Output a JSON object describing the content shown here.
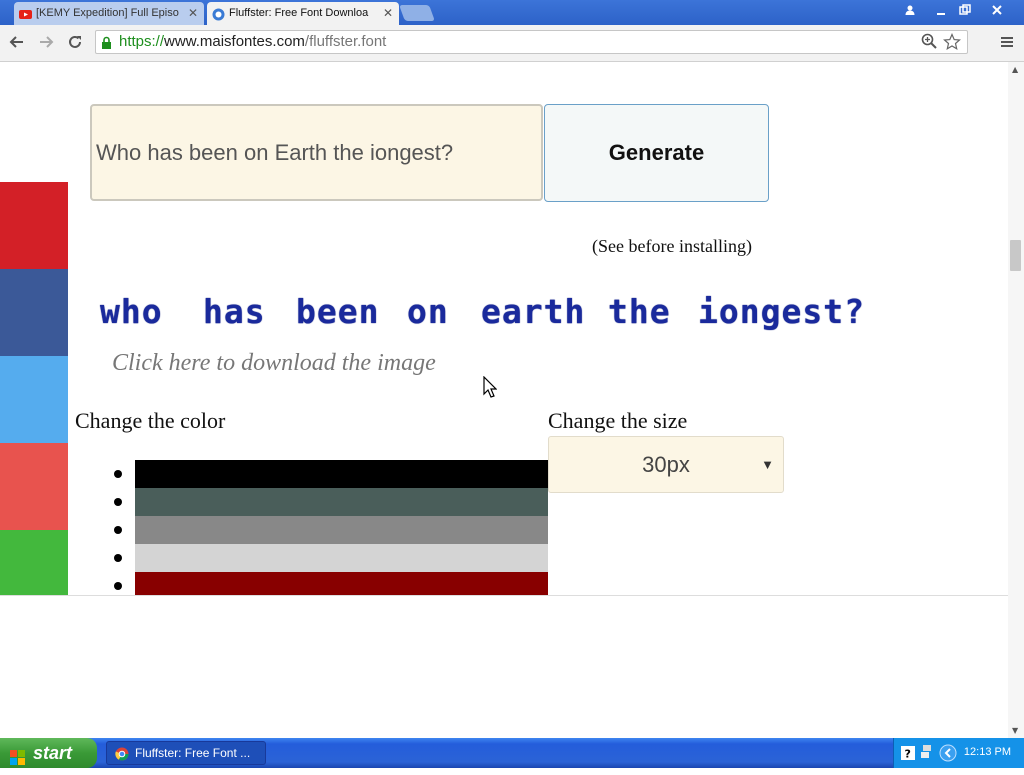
{
  "browser": {
    "tabs": [
      {
        "title": "[KEMY Expedition] Full Episo",
        "favicon": "youtube-icon",
        "active": false
      },
      {
        "title": "Fluffster: Free Font Downloa",
        "favicon": "maisfontes-icon",
        "active": true
      }
    ],
    "close_glyph": "✕",
    "url_scheme": "https://",
    "url_host": "www.maisfontes.com",
    "url_path": "/fluffster.font"
  },
  "page": {
    "text_value": "Who has been on Earth the iongest?",
    "generate_label": "Generate",
    "see_before": "(See before installing)",
    "preview_words": [
      "who",
      "has",
      "been",
      "on",
      "earth",
      "the",
      "iongest?"
    ],
    "preview_color": "#1a2a9c",
    "download_link": "Click here to download the image",
    "change_color_label": "Change the color",
    "change_size_label": "Change the size",
    "size_value": "30px",
    "swatches": [
      "#000000",
      "#4a5e5a",
      "#888888",
      "#d4d4d4",
      "#880000"
    ],
    "share_colors": [
      "#d32027",
      "#3b5998",
      "#55acee",
      "#e8534e",
      "#43b83d"
    ]
  },
  "taskbar": {
    "start_label": "start",
    "task_label": "Fluffster: Free Font ...",
    "clock": "12:13 PM"
  }
}
